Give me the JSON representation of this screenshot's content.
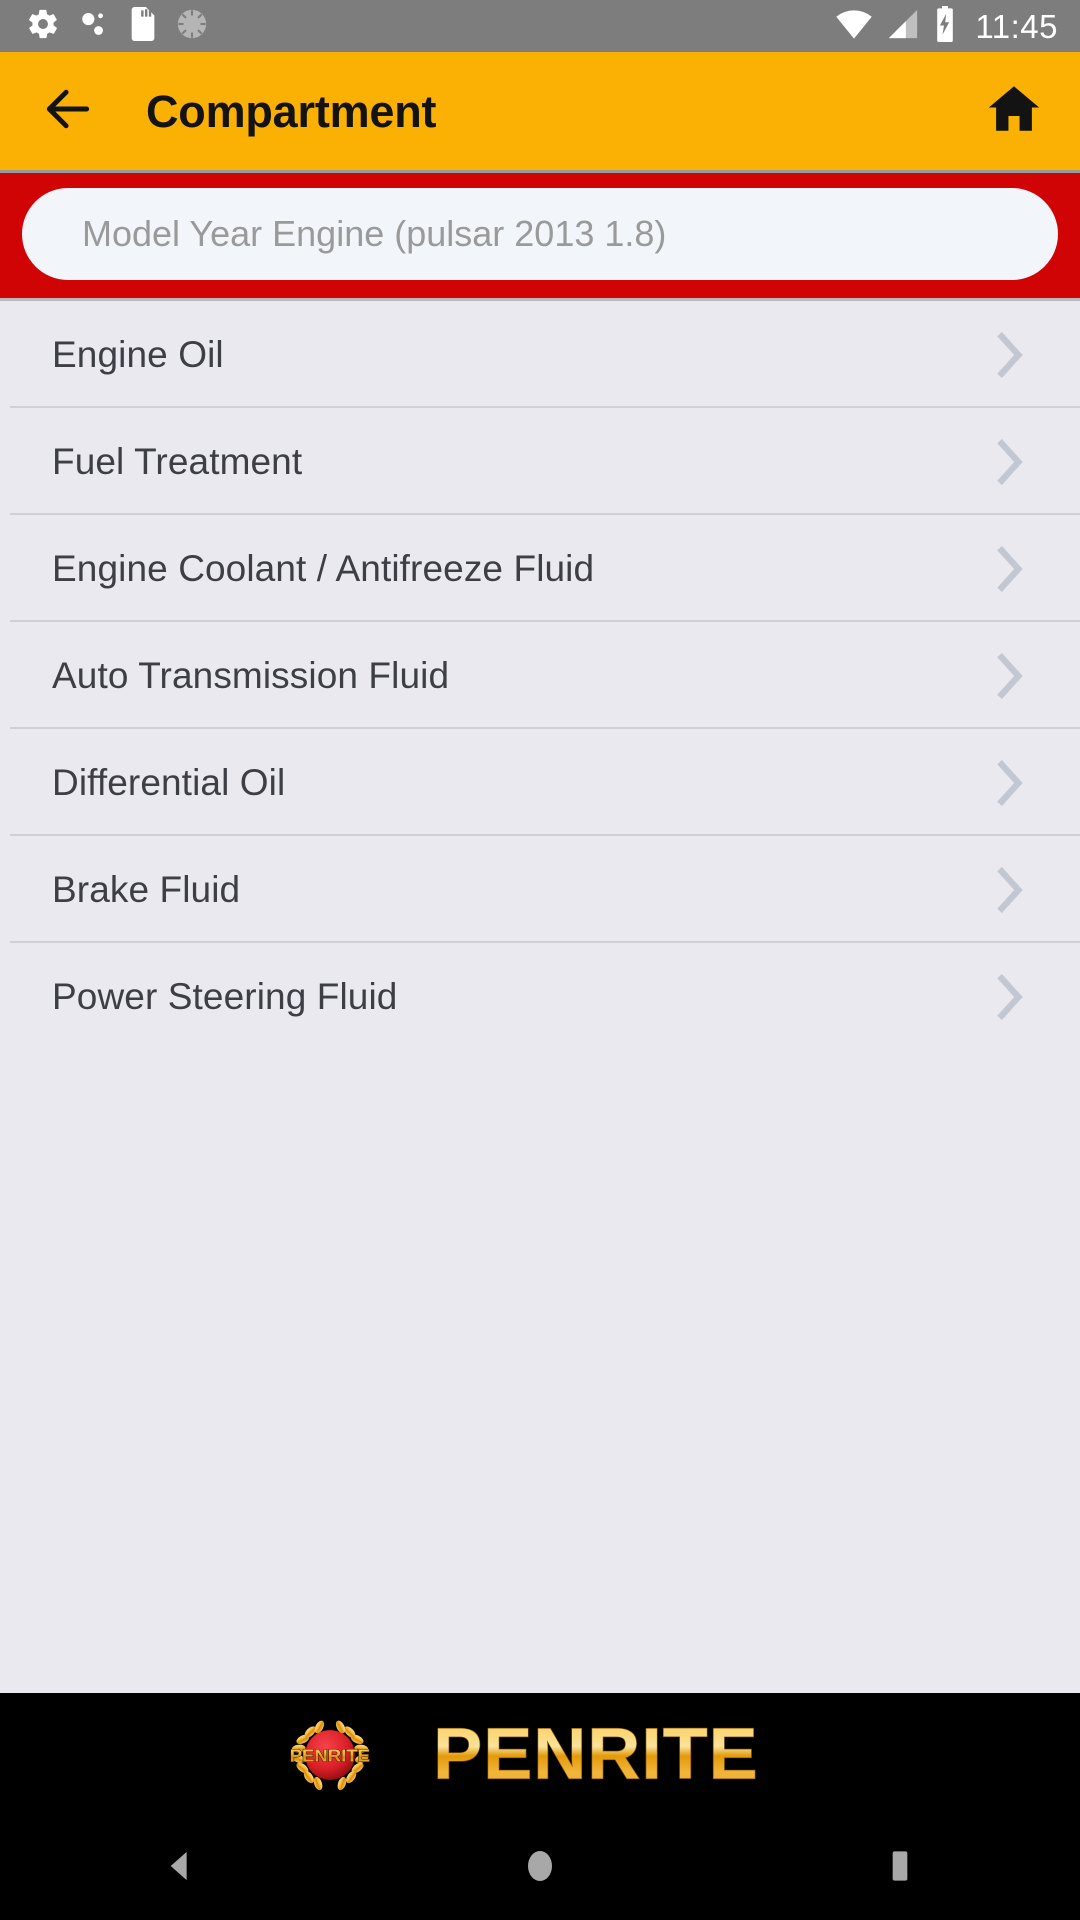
{
  "status_bar": {
    "background_color": "#7D7D7D",
    "time": "11:45",
    "left_icons": [
      {
        "name": "settings-gear-icon",
        "label": "Settings"
      },
      {
        "name": "developer-bubbles-icon",
        "label": "Debug"
      },
      {
        "name": "sd-card-icon",
        "label": "SD Card"
      },
      {
        "name": "sync-spinner-icon",
        "label": "Syncing"
      }
    ],
    "right_icons": [
      {
        "name": "wifi-icon",
        "label": "Wi-Fi"
      },
      {
        "name": "cellular-signal-icon",
        "label": "Mobile signal"
      },
      {
        "name": "battery-charging-icon",
        "label": "Battery charging"
      }
    ]
  },
  "app_bar": {
    "title": "Compartment",
    "background_color": "#FBB004",
    "back_label": "Back",
    "home_label": "Home"
  },
  "search": {
    "band_color": "#D00404",
    "placeholder": "Model Year Engine (pulsar 2013 1.8)",
    "value": ""
  },
  "list": {
    "items": [
      {
        "label": "Engine Oil"
      },
      {
        "label": "Fuel Treatment"
      },
      {
        "label": "Engine Coolant / Antifreeze Fluid"
      },
      {
        "label": "Auto Transmission Fluid"
      },
      {
        "label": "Differential Oil"
      },
      {
        "label": "Brake Fluid"
      },
      {
        "label": "Power Steering Fluid"
      }
    ]
  },
  "footer": {
    "brand": "PENRITE",
    "badge_text": "PENRITE",
    "background_color": "#000000",
    "gold_color": "#F6B426",
    "badge_red": "#E1232B"
  },
  "nav_bar": {
    "buttons": [
      {
        "name": "nav-back-button",
        "label": "Back"
      },
      {
        "name": "nav-home-button",
        "label": "Home"
      },
      {
        "name": "nav-recents-button",
        "label": "Recents"
      }
    ]
  }
}
